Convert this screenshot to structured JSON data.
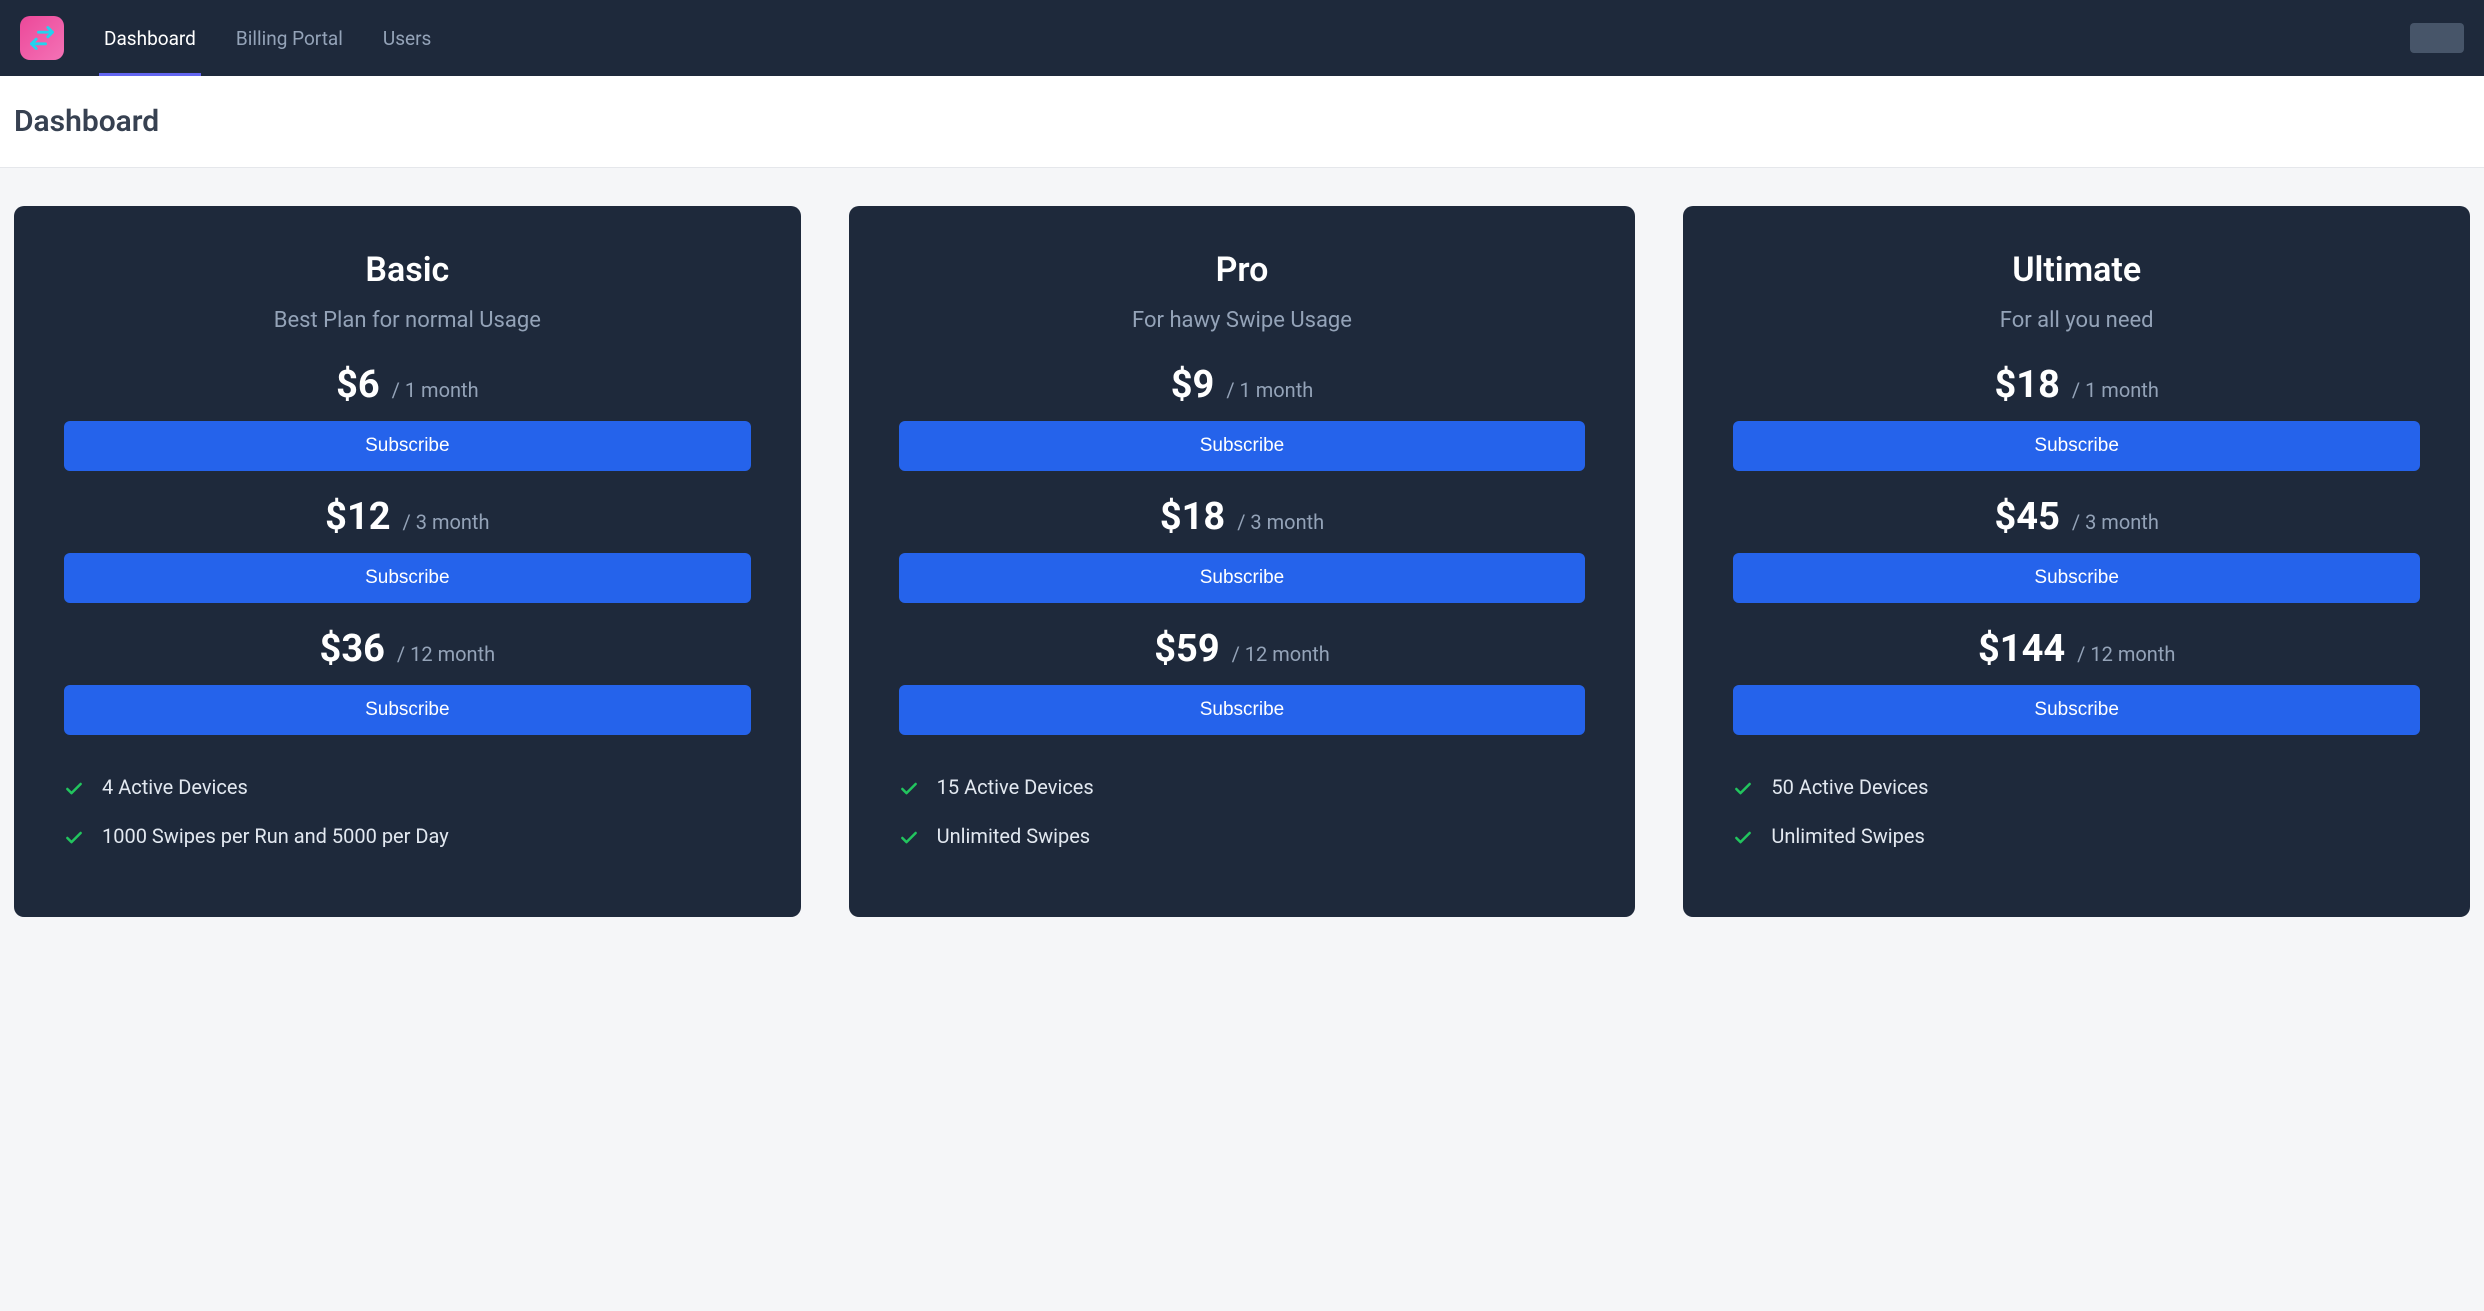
{
  "nav": {
    "items": [
      {
        "label": "Dashboard",
        "active": true
      },
      {
        "label": "Billing Portal",
        "active": false
      },
      {
        "label": "Users",
        "active": false
      }
    ]
  },
  "page": {
    "title": "Dashboard"
  },
  "plans": [
    {
      "name": "Basic",
      "desc": "Best Plan for normal Usage",
      "tiers": [
        {
          "price": "$6",
          "period": "/ 1 month",
          "button": "Subscribe"
        },
        {
          "price": "$12",
          "period": "/ 3 month",
          "button": "Subscribe"
        },
        {
          "price": "$36",
          "period": "/ 12 month",
          "button": "Subscribe"
        }
      ],
      "features": [
        "4 Active Devices",
        "1000 Swipes per Run and 5000 per Day"
      ]
    },
    {
      "name": "Pro",
      "desc": "For hawy Swipe Usage",
      "tiers": [
        {
          "price": "$9",
          "period": "/ 1 month",
          "button": "Subscribe"
        },
        {
          "price": "$18",
          "period": "/ 3 month",
          "button": "Subscribe"
        },
        {
          "price": "$59",
          "period": "/ 12 month",
          "button": "Subscribe"
        }
      ],
      "features": [
        "15 Active Devices",
        "Unlimited Swipes"
      ]
    },
    {
      "name": "Ultimate",
      "desc": "For all you need",
      "tiers": [
        {
          "price": "$18",
          "period": "/ 1 month",
          "button": "Subscribe"
        },
        {
          "price": "$45",
          "period": "/ 3 month",
          "button": "Subscribe"
        },
        {
          "price": "$144",
          "period": "/ 12 month",
          "button": "Subscribe"
        }
      ],
      "features": [
        "50 Active Devices",
        "Unlimited Swipes"
      ]
    }
  ]
}
